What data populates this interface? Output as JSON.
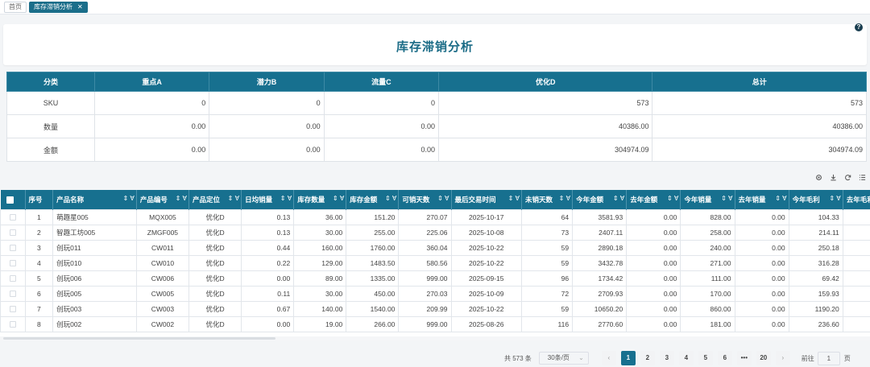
{
  "tabs": [
    {
      "label": "首页",
      "active": false
    },
    {
      "label": "库存滞销分析",
      "active": true
    }
  ],
  "title": "库存滞销分析",
  "help_symbol": "?",
  "summary": {
    "headers": [
      "分类",
      "重点A",
      "潜力B",
      "流量C",
      "优化D",
      "总计"
    ],
    "rows": [
      [
        "SKU",
        "0",
        "0",
        "0",
        "573",
        "573"
      ],
      [
        "数量",
        "0.00",
        "0.00",
        "0.00",
        "40386.00",
        "40386.00"
      ],
      [
        "金额",
        "0.00",
        "0.00",
        "0.00",
        "304974.09",
        "304974.09"
      ]
    ]
  },
  "table": {
    "headers": [
      "序号",
      "产品名称",
      "产品编号",
      "产品定位",
      "日均销量",
      "库存数量",
      "库存金额",
      "可销天数",
      "最后交易时间",
      "未销天数",
      "今年金额",
      "去年金额",
      "今年销量",
      "去年销量",
      "今年毛利",
      "去年毛利"
    ],
    "sort_filter_symbol": "⇕ ∀",
    "rows": [
      [
        "1",
        "萌趣星005",
        "MQX005",
        "优化D",
        "0.13",
        "36.00",
        "151.20",
        "270.07",
        "2025-10-17",
        "64",
        "3581.93",
        "0.00",
        "828.00",
        "0.00",
        "104.33"
      ],
      [
        "2",
        "智趣工坊005",
        "ZMGF005",
        "优化D",
        "0.13",
        "30.00",
        "255.00",
        "225.06",
        "2025-10-08",
        "73",
        "2407.11",
        "0.00",
        "258.00",
        "0.00",
        "214.11"
      ],
      [
        "3",
        "创玩011",
        "CW011",
        "优化D",
        "0.44",
        "160.00",
        "1760.00",
        "360.04",
        "2025-10-22",
        "59",
        "2890.18",
        "0.00",
        "240.00",
        "0.00",
        "250.18"
      ],
      [
        "4",
        "创玩010",
        "CW010",
        "优化D",
        "0.22",
        "129.00",
        "1483.50",
        "580.56",
        "2025-10-22",
        "59",
        "3432.78",
        "0.00",
        "271.00",
        "0.00",
        "316.28"
      ],
      [
        "5",
        "创玩006",
        "CW006",
        "优化D",
        "0.00",
        "89.00",
        "1335.00",
        "999.00",
        "2025-09-15",
        "96",
        "1734.42",
        "0.00",
        "111.00",
        "0.00",
        "69.42"
      ],
      [
        "6",
        "创玩005",
        "CW005",
        "优化D",
        "0.11",
        "30.00",
        "450.00",
        "270.03",
        "2025-10-09",
        "72",
        "2709.93",
        "0.00",
        "170.00",
        "0.00",
        "159.93"
      ],
      [
        "7",
        "创玩003",
        "CW003",
        "优化D",
        "0.67",
        "140.00",
        "1540.00",
        "209.99",
        "2025-10-22",
        "59",
        "10650.20",
        "0.00",
        "860.00",
        "0.00",
        "1190.20"
      ],
      [
        "8",
        "创玩002",
        "CW002",
        "优化D",
        "0.00",
        "19.00",
        "266.00",
        "999.00",
        "2025-08-26",
        "116",
        "2770.60",
        "0.00",
        "181.00",
        "0.00",
        "236.60"
      ]
    ]
  },
  "toolbar_icons": [
    "settings-icon",
    "download-icon",
    "refresh-icon",
    "columns-icon"
  ],
  "pagination": {
    "total": "共 573 条",
    "page_size": "30条/页",
    "pages": [
      "1",
      "2",
      "3",
      "4",
      "5",
      "6",
      "•••",
      "20"
    ],
    "current": "1",
    "prev": "‹",
    "next": "›",
    "goto_label": "前往",
    "goto_value": "1",
    "goto_unit": "页"
  },
  "colors": {
    "header": "#17708f",
    "accent": "#1a6b86"
  }
}
